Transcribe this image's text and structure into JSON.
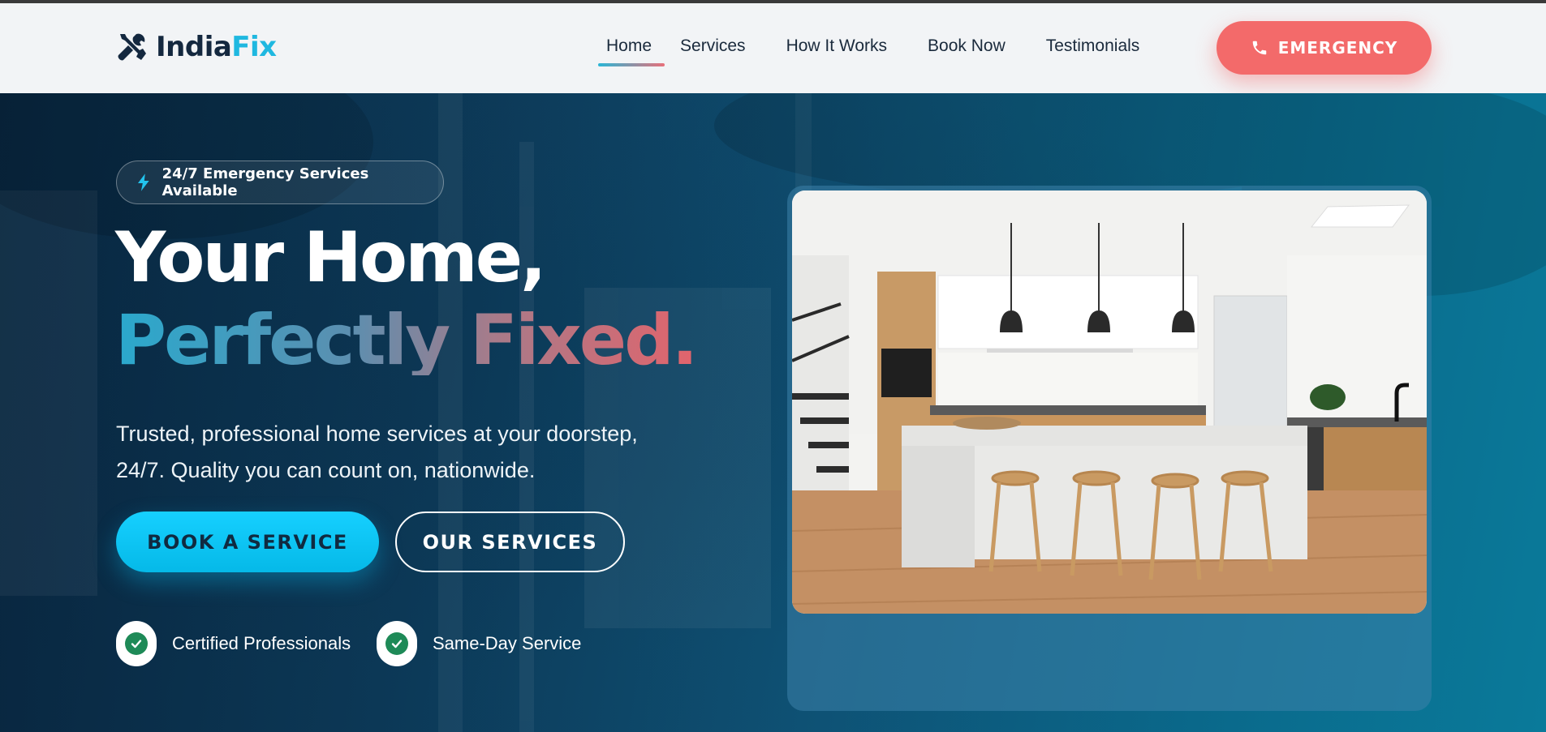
{
  "header": {
    "logo": {
      "part1": "India",
      "part2": "Fix"
    },
    "nav": [
      {
        "label": "Home",
        "active": true
      },
      {
        "label": "Services",
        "active": false
      },
      {
        "label": "How It Works",
        "active": false
      },
      {
        "label": "Book Now",
        "active": false
      },
      {
        "label": "Testimonials",
        "active": false
      }
    ],
    "emergency_label": "EMERGENCY",
    "emergency_icon": "phone-icon"
  },
  "hero": {
    "badge": {
      "icon": "bolt-icon",
      "text": "24/7 Emergency Services Available"
    },
    "title_line1": "Your Home,",
    "title_line2": "Perfectly Fixed.",
    "subtitle_line1": "Trusted, professional home services at your doorstep,",
    "subtitle_line2": "24/7. Quality you can count on, nationwide.",
    "primary_button": "BOOK A SERVICE",
    "secondary_button": "OUR SERVICES",
    "features": [
      {
        "icon": "check-icon",
        "label": "Certified Professionals"
      },
      {
        "icon": "check-icon",
        "label": "Same-Day Service"
      }
    ],
    "image_alt": "Modern kitchen with island and wooden stools"
  },
  "colors": {
    "brand_dark": "#14283f",
    "brand_accent": "#1fb8e0",
    "emergency": "#f36a6a",
    "primary_button": "#16d0ff",
    "check_green": "#1e8a57"
  }
}
